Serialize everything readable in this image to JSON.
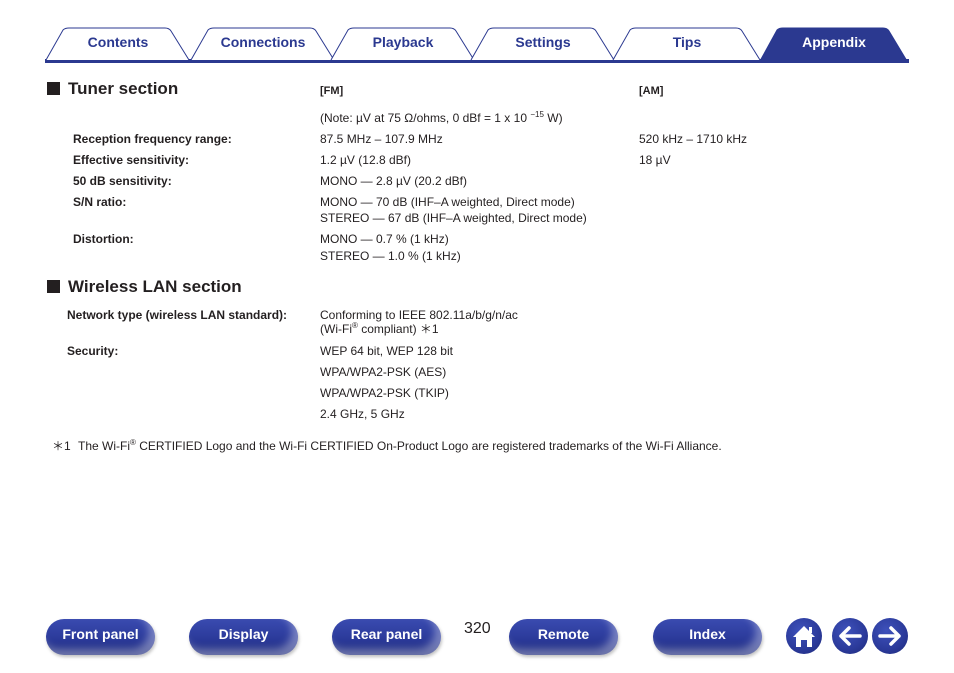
{
  "tabs": [
    {
      "label": "Contents",
      "active": false
    },
    {
      "label": "Connections",
      "active": false
    },
    {
      "label": "Playback",
      "active": false
    },
    {
      "label": "Settings",
      "active": false
    },
    {
      "label": "Tips",
      "active": false
    },
    {
      "label": "Appendix",
      "active": true
    }
  ],
  "colors": {
    "brand": "#2b3990",
    "text": "#231f20"
  },
  "tuner": {
    "title": "Tuner section",
    "fm_header": "[FM]",
    "am_header": "[AM]",
    "note_prefix": "(Note: µV at 75 Ω/ohms, 0 dBf = 1 x 10 ",
    "note_exp": "−15",
    "note_suffix": " W)",
    "rows": [
      {
        "label": "Reception frequency range:",
        "fm": [
          "87.5 MHz – 107.9 MHz"
        ],
        "am": "520 kHz – 1710 kHz"
      },
      {
        "label": "Effective sensitivity:",
        "fm": [
          "1.2 µV (12.8 dBf)"
        ],
        "am": "18 µV"
      },
      {
        "label": "50 dB sensitivity:",
        "fm": [
          "MONO — 2.8 µV (20.2 dBf)"
        ],
        "am": ""
      },
      {
        "label": "S/N ratio:",
        "fm": [
          "MONO — 70 dB (IHF–A weighted, Direct mode)",
          "STEREO — 67 dB (IHF–A weighted, Direct mode)"
        ],
        "am": ""
      },
      {
        "label": "Distortion:",
        "fm": [
          "MONO — 0.7 % (1 kHz)",
          "STEREO — 1.0 % (1 kHz)"
        ],
        "am": ""
      }
    ]
  },
  "wlan": {
    "title": "Wireless LAN section",
    "network_label": "Network type (wireless LAN standard):",
    "network_line1": "Conforming to IEEE 802.11a/b/g/n/ac",
    "network_line2_pre": "(Wi-Fi",
    "network_line2_reg": "®",
    "network_line2_post": " compliant) ＊1",
    "security_label": "Security:",
    "security_values": [
      "WEP 64 bit, WEP 128 bit",
      "WPA/WPA2-PSK (AES)",
      "WPA/WPA2-PSK (TKIP)"
    ],
    "band": "2.4 GHz, 5 GHz"
  },
  "footnote": {
    "mark": "＊1",
    "pre": "The Wi-Fi",
    "reg": "®",
    "post": " CERTIFIED Logo and the Wi-Fi CERTIFIED On-Product Logo are registered trademarks of the Wi-Fi Alliance."
  },
  "bottom_nav": {
    "buttons": [
      "Front panel",
      "Display",
      "Rear panel",
      "Remote",
      "Index"
    ],
    "page_number": "320",
    "icons": [
      "home-icon",
      "back-arrow-icon",
      "forward-arrow-icon"
    ]
  }
}
